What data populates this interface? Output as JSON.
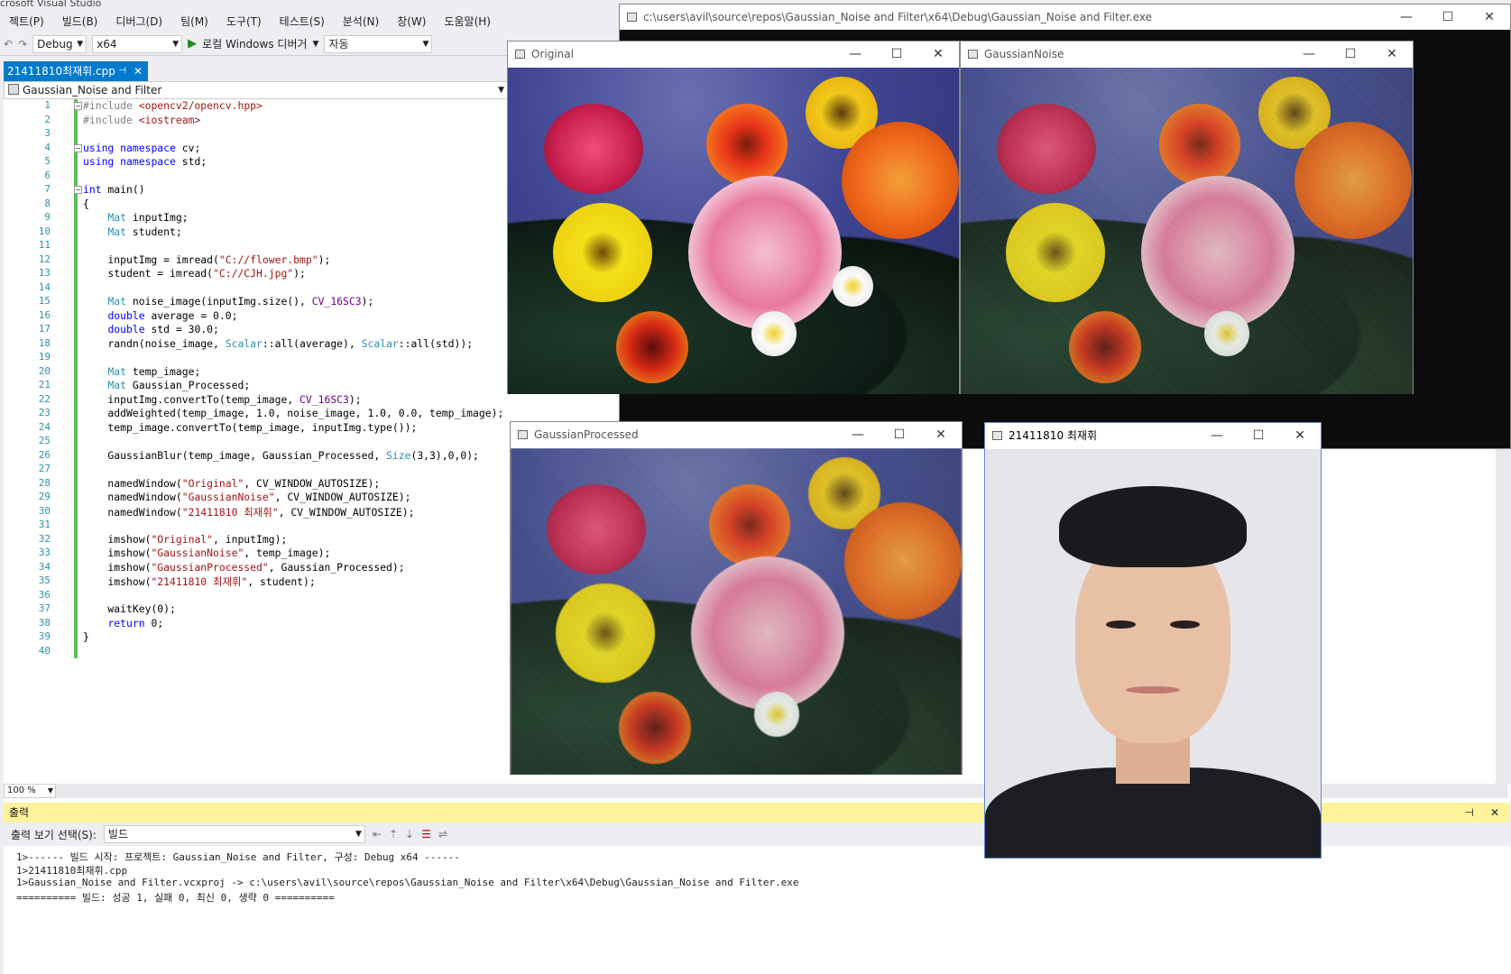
{
  "vs": {
    "title": "crosoft Visual Studio",
    "menu": [
      "젝트(P)",
      "빌드(B)",
      "디버그(D)",
      "팀(M)",
      "도구(T)",
      "테스트(S)",
      "분석(N)",
      "창(W)",
      "도움말(H)"
    ],
    "toolbar": {
      "config": "Debug",
      "platform": "x64",
      "run_label": "로컬 Windows 디버거",
      "auto": "자동"
    },
    "tab": {
      "label": "21411810최재휘.cpp"
    },
    "nav": {
      "scope": "Gaussian_Noise and Filter"
    },
    "zoom": "100 %"
  },
  "code_lines": [
    {
      "n": "1",
      "t": "#include <opencv2/opencv.hpp>"
    },
    {
      "n": "2",
      "t": "#include <iostream>"
    },
    {
      "n": "3",
      "t": ""
    },
    {
      "n": "4",
      "t": "using namespace cv;"
    },
    {
      "n": "5",
      "t": "using namespace std;"
    },
    {
      "n": "6",
      "t": ""
    },
    {
      "n": "7",
      "t": "int main()"
    },
    {
      "n": "8",
      "t": "{"
    },
    {
      "n": "9",
      "t": "    Mat inputImg;"
    },
    {
      "n": "10",
      "t": "    Mat student;"
    },
    {
      "n": "11",
      "t": ""
    },
    {
      "n": "12",
      "t": "    inputImg = imread(\"C://flower.bmp\");"
    },
    {
      "n": "13",
      "t": "    student = imread(\"C://CJH.jpg\");"
    },
    {
      "n": "14",
      "t": ""
    },
    {
      "n": "15",
      "t": "    Mat noise_image(inputImg.size(), CV_16SC3);"
    },
    {
      "n": "16",
      "t": "    double average = 0.0;"
    },
    {
      "n": "17",
      "t": "    double std = 30.0;"
    },
    {
      "n": "18",
      "t": "    randn(noise_image, Scalar::all(average), Scalar::all(std));"
    },
    {
      "n": "19",
      "t": ""
    },
    {
      "n": "20",
      "t": "    Mat temp_image;"
    },
    {
      "n": "21",
      "t": "    Mat Gaussian_Processed;"
    },
    {
      "n": "22",
      "t": "    inputImg.convertTo(temp_image, CV_16SC3);"
    },
    {
      "n": "23",
      "t": "    addWeighted(temp_image, 1.0, noise_image, 1.0, 0.0, temp_image);"
    },
    {
      "n": "24",
      "t": "    temp_image.convertTo(temp_image, inputImg.type());"
    },
    {
      "n": "25",
      "t": ""
    },
    {
      "n": "26",
      "t": "    GaussianBlur(temp_image, Gaussian_Processed, Size(3,3),0,0);"
    },
    {
      "n": "27",
      "t": ""
    },
    {
      "n": "28",
      "t": "    namedWindow(\"Original\", CV_WINDOW_AUTOSIZE);"
    },
    {
      "n": "29",
      "t": "    namedWindow(\"GaussianNoise\", CV_WINDOW_AUTOSIZE);"
    },
    {
      "n": "30",
      "t": "    namedWindow(\"21411810 최재휘\", CV_WINDOW_AUTOSIZE);"
    },
    {
      "n": "31",
      "t": ""
    },
    {
      "n": "32",
      "t": "    imshow(\"Original\", inputImg);"
    },
    {
      "n": "33",
      "t": "    imshow(\"GaussianNoise\", temp_image);"
    },
    {
      "n": "34",
      "t": "    imshow(\"GaussianProcessed\", Gaussian_Processed);"
    },
    {
      "n": "35",
      "t": "    imshow(\"21411810 최재휘\", student);"
    },
    {
      "n": "36",
      "t": ""
    },
    {
      "n": "37",
      "t": "    waitKey(0);"
    },
    {
      "n": "38",
      "t": "    return 0;"
    },
    {
      "n": "39",
      "t": "}"
    },
    {
      "n": "40",
      "t": ""
    }
  ],
  "output": {
    "header": "출력",
    "show_label": "출력 보기 선택(S):",
    "source": "빌드",
    "lines": [
      "1>------ 빌드 시작: 프로젝트: Gaussian_Noise and Filter, 구성: Debug x64 ------",
      "1>21411810최재휘.cpp",
      "1>Gaussian_Noise and Filter.vcxproj -> c:\\users\\avil\\source\\repos\\Gaussian_Noise and Filter\\x64\\Debug\\Gaussian_Noise and Filter.exe",
      "========== 빌드: 성공 1, 실패 0, 최신 0, 생략 0 =========="
    ]
  },
  "windows": {
    "console": "c:\\users\\avil\\source\\repos\\Gaussian_Noise and Filter\\x64\\Debug\\Gaussian_Noise and Filter.exe",
    "original": "Original",
    "noise": "GaussianNoise",
    "processed": "GaussianProcessed",
    "student": "21411810 최재휘"
  },
  "controls": {
    "minimize": "—",
    "maximize": "☐",
    "close": "✕"
  }
}
